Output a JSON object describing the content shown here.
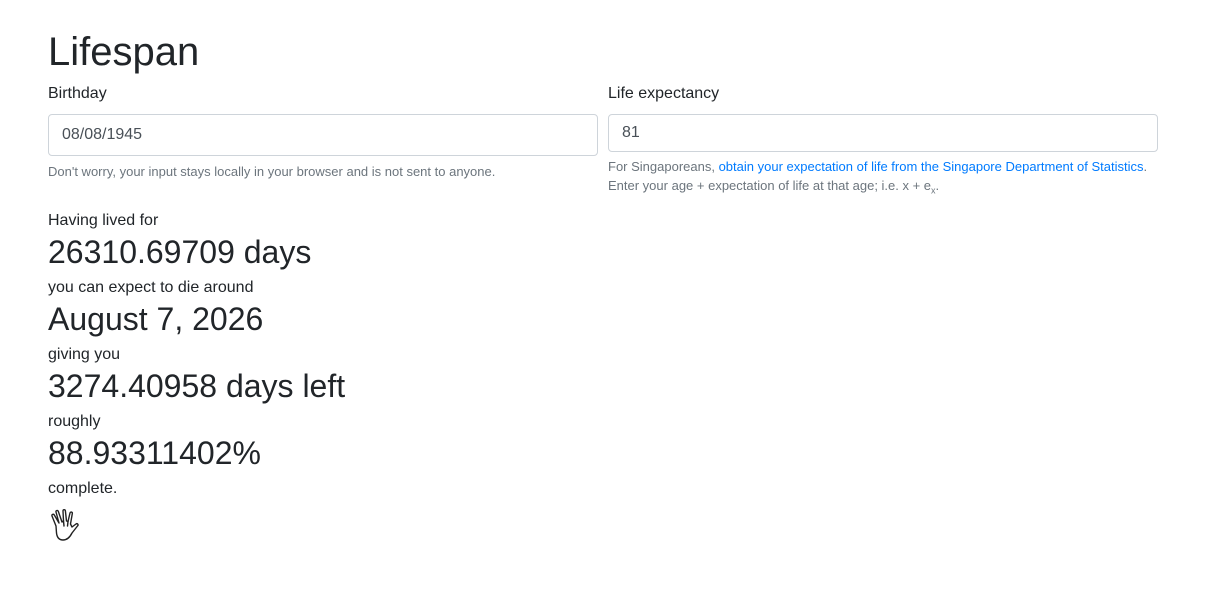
{
  "page": {
    "title": "Lifespan"
  },
  "birthday": {
    "label": "Birthday",
    "value": "08/08/1945",
    "help": "Don't worry, your input stays locally in your browser and is not sent to anyone."
  },
  "life_expectancy": {
    "label": "Life expectancy",
    "value": "81",
    "help_prefix": "For Singaporeans, ",
    "help_link": "obtain your expectation of life from the Singapore Department of Statistics",
    "help_suffix": ".",
    "help_line2": "Enter your age + expectation of life at that age; i.e. x + e",
    "help_line2_sub": "x",
    "help_line2_end": "."
  },
  "results": {
    "lived_label": "Having lived for",
    "lived_value": "26310.69709 days",
    "die_label": "you can expect to die around",
    "die_value": "August 7, 2026",
    "left_label": "giving you",
    "left_value": "3274.40958 days left",
    "roughly_label": "roughly",
    "percent_value": "88.93311402%",
    "complete_label": "complete."
  },
  "icons": {
    "hand": "vulcan-salute-icon"
  }
}
